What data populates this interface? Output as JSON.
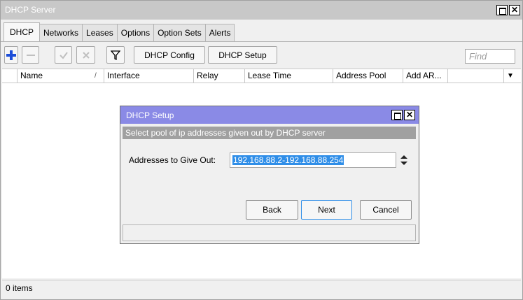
{
  "window": {
    "title": "DHCP Server"
  },
  "tabs": [
    "DHCP",
    "Networks",
    "Leases",
    "Options",
    "Option Sets",
    "Alerts"
  ],
  "toolbar": {
    "add_icon": "plus-icon",
    "remove_icon": "minus-icon",
    "enable_icon": "check-icon",
    "disable_icon": "cross-icon",
    "filter_icon": "filter-icon",
    "dhcp_config_label": "DHCP Config",
    "dhcp_setup_label": "DHCP Setup",
    "find_placeholder": "Find"
  },
  "table": {
    "columns": [
      "Name",
      "/",
      "Interface",
      "Relay",
      "Lease Time",
      "Address Pool",
      "Add AR...",
      ""
    ],
    "rows": []
  },
  "status": {
    "items": "0 items"
  },
  "dialog": {
    "title": "DHCP Setup",
    "info": "Select pool of ip addresses given out by DHCP server",
    "field_label": "Addresses to Give Out:",
    "field_value": "192.168.88.2-192.168.88.254",
    "back_label": "Back",
    "next_label": "Next",
    "cancel_label": "Cancel"
  },
  "colors": {
    "dialog_title_bg": "#8a8ae6",
    "selection": "#2f8ee8",
    "add_icon": "#1d4ed8"
  }
}
